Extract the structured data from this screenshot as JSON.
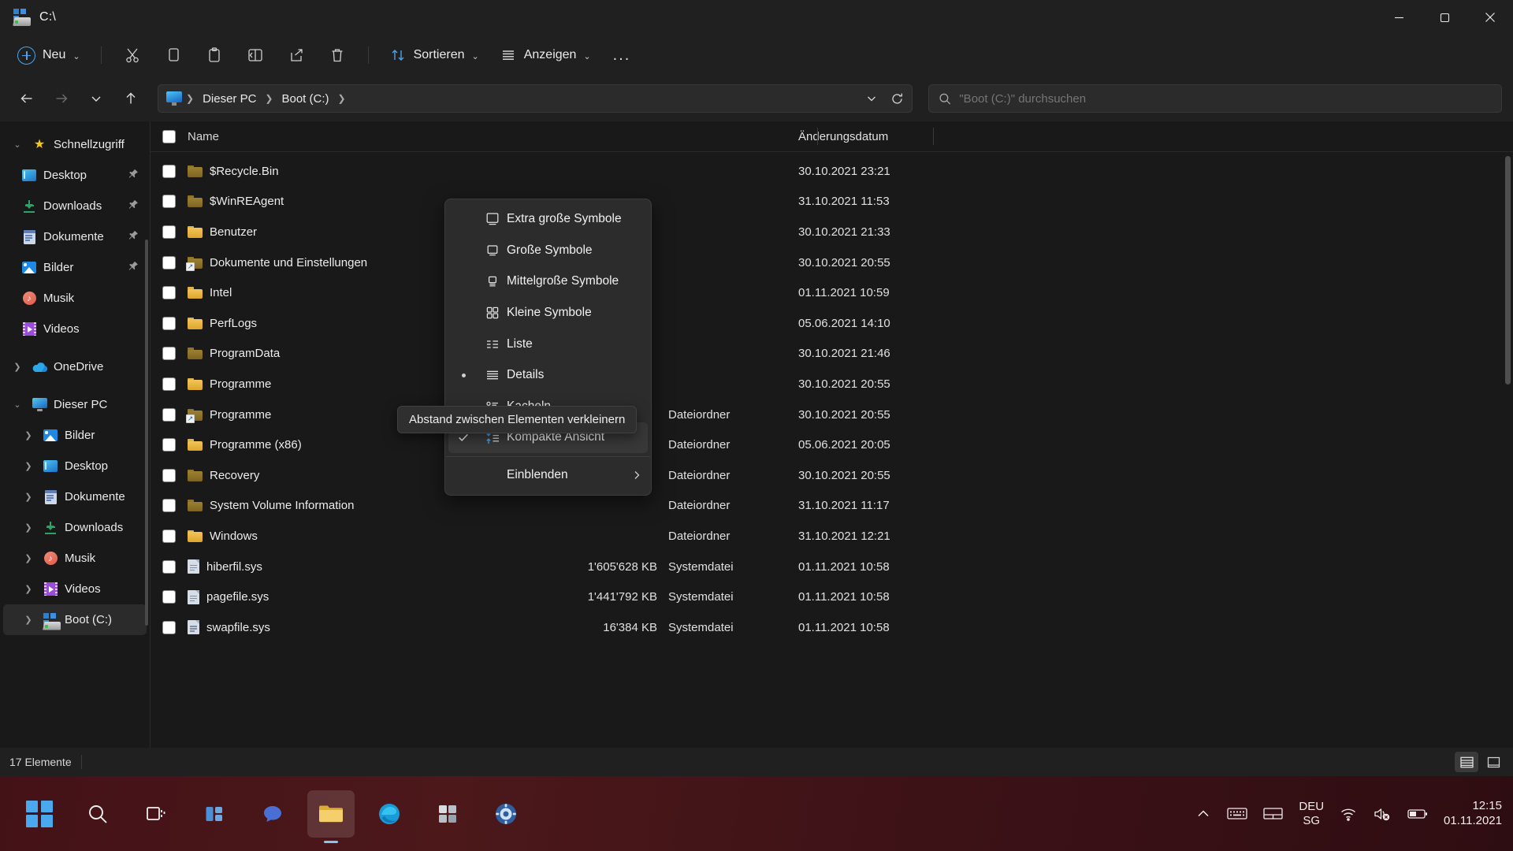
{
  "window": {
    "title": "C:\\",
    "drive_icon": "drive-icon",
    "minimize_label": "Minimieren",
    "maximize_label": "Maximieren",
    "close_label": "Schließen"
  },
  "toolbar": {
    "new_label": "Neu",
    "items": [
      {
        "name": "cut-button",
        "icon": "scissors-icon"
      },
      {
        "name": "copy-button",
        "icon": "copy-icon"
      },
      {
        "name": "paste-button",
        "icon": "clipboard-icon"
      },
      {
        "name": "rename-button",
        "icon": "rename-icon"
      },
      {
        "name": "share-button",
        "icon": "share-icon"
      },
      {
        "name": "delete-button",
        "icon": "trash-icon"
      }
    ],
    "sort_label": "Sortieren",
    "view_label": "Anzeigen",
    "more_label": "..."
  },
  "navigation": {
    "back_tooltip": "Zurück",
    "forward_tooltip": "Vorwärts",
    "recent_tooltip": "Zuletzt verwendete Orte",
    "up_tooltip": "Nach oben",
    "breadcrumb": [
      "Dieser PC",
      "Boot (C:)"
    ],
    "refresh_label": "Aktualisieren",
    "dropdown_label": "Vorherige Speicherorte"
  },
  "search": {
    "placeholder": "\"Boot (C:)\" durchsuchen",
    "value": "",
    "icon": "search-icon"
  },
  "sidebar": {
    "groups": [
      {
        "label": "Schnellzugriff",
        "icon": "star-icon",
        "expanded": true,
        "level": 1,
        "pinned": false
      },
      {
        "label": "Desktop",
        "icon": "desktop-icon",
        "level": 2,
        "pinned": true
      },
      {
        "label": "Downloads",
        "icon": "download-icon",
        "level": 2,
        "pinned": true
      },
      {
        "label": "Dokumente",
        "icon": "document-icon",
        "level": 2,
        "pinned": true
      },
      {
        "label": "Bilder",
        "icon": "pictures-icon",
        "level": 2,
        "pinned": true
      },
      {
        "label": "Musik",
        "icon": "music-icon",
        "level": 2,
        "pinned": false
      },
      {
        "label": "Videos",
        "icon": "videos-icon",
        "level": 2,
        "pinned": false
      },
      {
        "label": "OneDrive",
        "icon": "onedrive-icon",
        "level": 1,
        "expanded": false,
        "pinned": false
      },
      {
        "label": "Dieser PC",
        "icon": "pc-icon",
        "level": 1,
        "expanded": true,
        "pinned": false
      },
      {
        "label": "Bilder",
        "icon": "pictures-icon",
        "level": 2,
        "collapsed": true,
        "pinned": false
      },
      {
        "label": "Desktop",
        "icon": "desktop-icon",
        "level": 2,
        "collapsed": true,
        "pinned": false
      },
      {
        "label": "Dokumente",
        "icon": "document-icon",
        "level": 2,
        "collapsed": true,
        "pinned": false
      },
      {
        "label": "Downloads",
        "icon": "download-icon",
        "level": 2,
        "collapsed": true,
        "pinned": false
      },
      {
        "label": "Musik",
        "icon": "music-icon",
        "level": 2,
        "collapsed": true,
        "pinned": false
      },
      {
        "label": "Videos",
        "icon": "videos-icon",
        "level": 2,
        "collapsed": true,
        "pinned": false
      },
      {
        "label": "Boot (C:)",
        "icon": "drive-icon",
        "level": 2,
        "collapsed": true,
        "selected": true,
        "pinned": false
      }
    ]
  },
  "filelist": {
    "columns": [
      {
        "key": "name",
        "label": "Name"
      },
      {
        "key": "size",
        "label": ""
      },
      {
        "key": "type",
        "label": ""
      },
      {
        "key": "date",
        "label": "Änderungsdatum"
      }
    ],
    "rows": [
      {
        "name": "$Recycle.Bin",
        "icon": "folder-hidden-icon",
        "size": "",
        "type": "",
        "date": "30.10.2021 23:21"
      },
      {
        "name": "$WinREAgent",
        "icon": "folder-hidden-icon",
        "size": "",
        "type": "",
        "date": "31.10.2021 11:53"
      },
      {
        "name": "Benutzer",
        "icon": "folder-icon",
        "size": "",
        "type": "",
        "date": "30.10.2021 21:33"
      },
      {
        "name": "Dokumente und Einstellungen",
        "icon": "folder-shortcut-hidden-icon",
        "size": "",
        "type": "",
        "date": "30.10.2021 20:55"
      },
      {
        "name": "Intel",
        "icon": "folder-icon",
        "size": "",
        "type": "",
        "date": "01.11.2021 10:59"
      },
      {
        "name": "PerfLogs",
        "icon": "folder-icon",
        "size": "",
        "type": "",
        "date": "05.06.2021 14:10"
      },
      {
        "name": "ProgramData",
        "icon": "folder-hidden-icon",
        "size": "",
        "type": "",
        "date": "30.10.2021 21:46"
      },
      {
        "name": "Programme",
        "icon": "folder-icon",
        "size": "",
        "type": "",
        "date": "30.10.2021 20:55"
      },
      {
        "name": "Programme",
        "icon": "folder-shortcut-hidden-icon",
        "size": "",
        "type": "Dateiordner",
        "date": "30.10.2021 20:55"
      },
      {
        "name": "Programme (x86)",
        "icon": "folder-icon",
        "size": "",
        "type": "Dateiordner",
        "date": "05.06.2021 20:05"
      },
      {
        "name": "Recovery",
        "icon": "folder-hidden-icon",
        "size": "",
        "type": "Dateiordner",
        "date": "30.10.2021 20:55"
      },
      {
        "name": "System Volume Information",
        "icon": "folder-hidden-icon",
        "size": "",
        "type": "Dateiordner",
        "date": "31.10.2021 11:17"
      },
      {
        "name": "Windows",
        "icon": "folder-icon",
        "size": "",
        "type": "Dateiordner",
        "date": "31.10.2021 12:21"
      },
      {
        "name": "hiberfil.sys",
        "icon": "system-file-icon",
        "size": "1'605'628 KB",
        "type": "Systemdatei",
        "date": "01.11.2021 10:58"
      },
      {
        "name": "pagefile.sys",
        "icon": "system-file-icon",
        "size": "1'441'792 KB",
        "type": "Systemdatei",
        "date": "01.11.2021 10:58"
      },
      {
        "name": "swapfile.sys",
        "icon": "system-file-icon",
        "size": "16'384 KB",
        "type": "Systemdatei",
        "date": "01.11.2021 10:58"
      }
    ]
  },
  "view_menu": {
    "items": [
      {
        "label": "Extra große Symbole",
        "icon": "extra-large-icons-icon",
        "checked": false,
        "bullet": false
      },
      {
        "label": "Große Symbole",
        "icon": "large-icons-icon",
        "checked": false,
        "bullet": false
      },
      {
        "label": "Mittelgroße Symbole",
        "icon": "medium-icons-icon",
        "checked": false,
        "bullet": false
      },
      {
        "label": "Kleine Symbole",
        "icon": "small-icons-icon",
        "checked": false,
        "bullet": false
      },
      {
        "label": "Liste",
        "icon": "list-icon",
        "checked": false,
        "bullet": false
      },
      {
        "label": "Details",
        "icon": "details-icon",
        "checked": false,
        "bullet": true
      },
      {
        "label": "Kacheln",
        "icon": "tiles-icon",
        "checked": false,
        "bullet": false
      }
    ],
    "compact": {
      "label": "Kompakte Ansicht",
      "icon": "compact-view-icon",
      "checked": true,
      "highlighted": true
    },
    "show": {
      "label": "Einblenden",
      "icon": "chevron-right-icon",
      "has_submenu": true
    }
  },
  "tooltip": {
    "text": "Abstand zwischen Elementen verkleinern"
  },
  "statusbar": {
    "count_label": "17 Elemente",
    "details_view_label": "Detailansicht",
    "large_icons_view_label": "Große Symbolansicht"
  },
  "taskbar": {
    "items": [
      {
        "name": "start-button",
        "icon": "windows-logo-icon"
      },
      {
        "name": "search-button",
        "icon": "search-icon"
      },
      {
        "name": "task-view-button",
        "icon": "task-view-icon"
      },
      {
        "name": "widgets-button",
        "icon": "widgets-icon"
      },
      {
        "name": "chat-button",
        "icon": "chat-icon"
      },
      {
        "name": "file-explorer-button",
        "icon": "folder-icon",
        "active": true
      },
      {
        "name": "edge-button",
        "icon": "edge-icon"
      },
      {
        "name": "store-button",
        "icon": "store-icon"
      },
      {
        "name": "settings-button",
        "icon": "settings-gear-icon"
      }
    ],
    "tray": {
      "overflow_icon": "chevron-up-icon",
      "keyboard_icon": "keyboard-icon",
      "touchpad_icon": "touchpad-icon",
      "language_line1": "DEU",
      "language_line2": "SG",
      "wifi_icon": "wifi-icon",
      "volume_icon": "volume-muted-icon",
      "battery_icon": "battery-icon",
      "time": "12:15",
      "date": "01.11.2021"
    }
  },
  "colors": {
    "accent": "#4ea3e8",
    "window_bg": "#191919",
    "chrome_bg": "#202020",
    "menu_bg": "#2c2c2c",
    "taskbar": "#431217",
    "folder": "#f2c45a"
  }
}
